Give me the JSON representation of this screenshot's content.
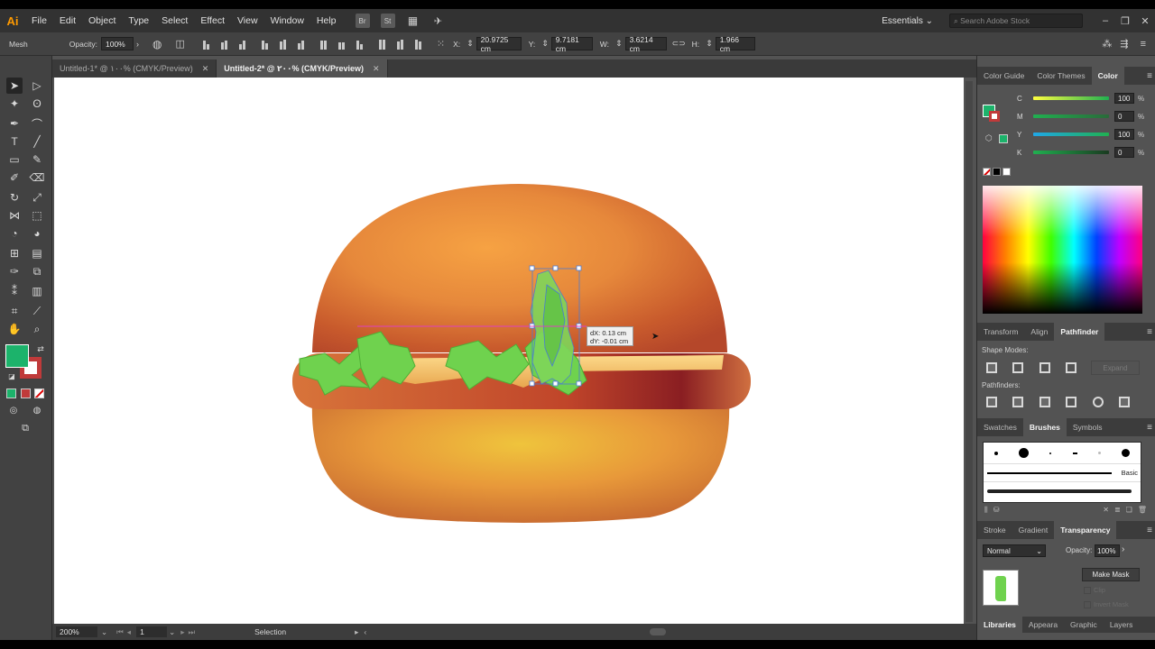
{
  "app": {
    "logo": "Ai",
    "menus": [
      "File",
      "Edit",
      "Object",
      "Type",
      "Select",
      "Effect",
      "View",
      "Window",
      "Help"
    ],
    "bridge_label": "Br",
    "stock_label": "St",
    "workspace": "Essentials",
    "search_placeholder": "Search Adobe Stock"
  },
  "control_bar": {
    "tool_label": "Mesh",
    "opacity_label": "Opacity:",
    "opacity_value": "100%",
    "x_label": "X:",
    "x_value": "20.9725 cm",
    "y_label": "Y:",
    "y_value": "9.7181 cm",
    "w_label": "W:",
    "w_value": "3.6214 cm",
    "h_label": "H:",
    "h_value": "1.966 cm"
  },
  "tabs": [
    {
      "label": "Untitled-1* @ ١٠٠% (CMYK/Preview)",
      "active": false
    },
    {
      "label": "Untitled-2* @ ٢٠٠% (CMYK/Preview)",
      "active": true
    }
  ],
  "canvas": {
    "tooltip_dx": "dX: 0.13 cm",
    "tooltip_dy": "dY: -0.01 cm"
  },
  "status_bar": {
    "zoom": "200%",
    "artboard_number": "1",
    "tool_status": "Selection"
  },
  "colors": {
    "fill": "#1cb36b",
    "stroke": "#c03a3a",
    "bun_mid": "#e08a3a",
    "bun_dark": "#a8321e",
    "bun_light": "#f4b040",
    "lettuce": "#6fd24e",
    "selection": "#4a7bd4"
  },
  "color_panel": {
    "tabs": [
      "Color Guide",
      "Color Themes",
      "Color"
    ],
    "active_tab": "Color",
    "channels": [
      {
        "label": "C",
        "value": "100",
        "fraction": 1.0
      },
      {
        "label": "M",
        "value": "0",
        "fraction": 0.0
      },
      {
        "label": "Y",
        "value": "100",
        "fraction": 1.0
      },
      {
        "label": "K",
        "value": "0",
        "fraction": 0.0
      }
    ],
    "percent_sign": "%"
  },
  "pathfinder_panel": {
    "tabs": [
      "Transform",
      "Align",
      "Pathfinder"
    ],
    "active_tab": "Pathfinder",
    "shape_modes_label": "Shape Modes:",
    "pathfinders_label": "Pathfinders:",
    "expand_label": "Expand"
  },
  "brushes_panel": {
    "tabs": [
      "Swatches",
      "Brushes",
      "Symbols"
    ],
    "active_tab": "Brushes",
    "basic_label": "Basic"
  },
  "transparency_panel": {
    "tabs": [
      "Stroke",
      "Gradient",
      "Transparency"
    ],
    "active_tab": "Transparency",
    "blend_mode": "Normal",
    "opacity_label": "Opacity:",
    "opacity_value": "100%",
    "make_mask_label": "Make Mask",
    "clip_label": "Clip",
    "invert_mask_label": "Invert Mask"
  },
  "bottom_tabs": [
    "Libraries",
    "Appeara",
    "Graphic",
    "Layers"
  ]
}
